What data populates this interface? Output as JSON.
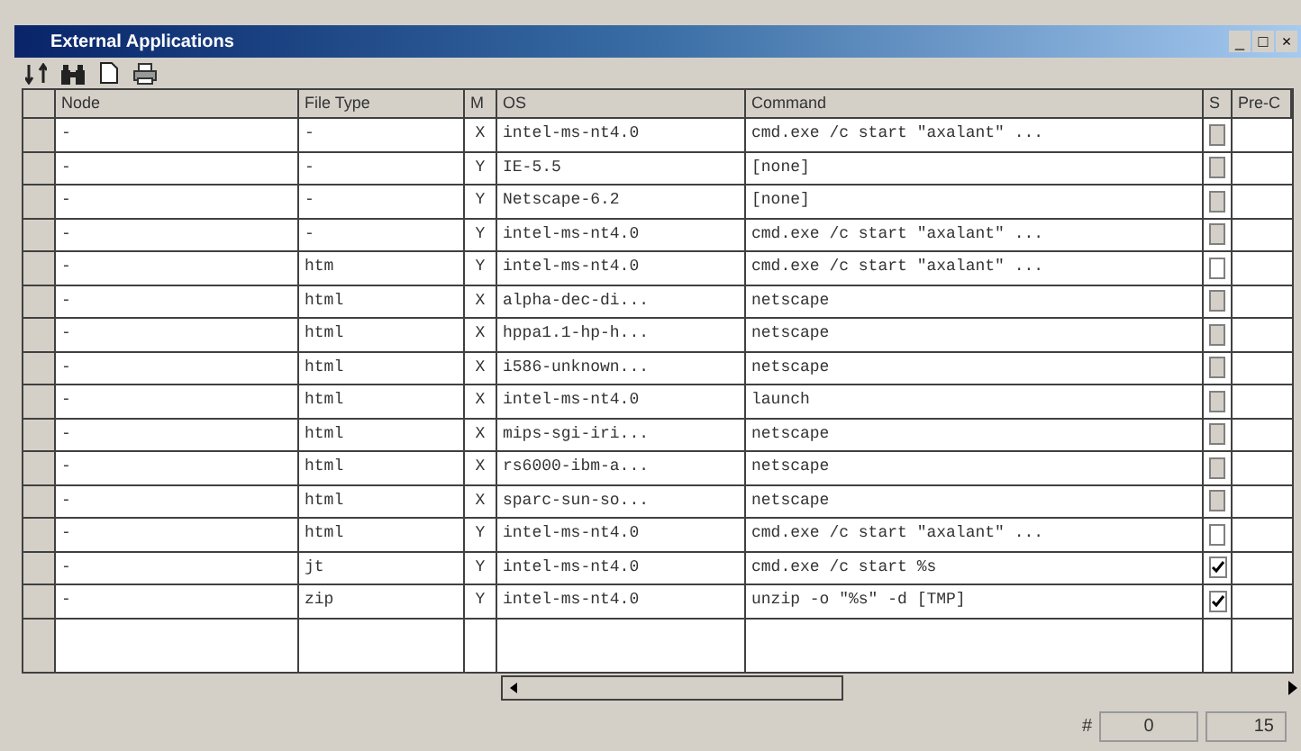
{
  "window": {
    "title": "External Applications",
    "controls": [
      "_",
      "□",
      "×"
    ]
  },
  "table": {
    "columns": [
      "Node",
      "File Type",
      "M",
      "OS",
      "Command",
      "S",
      "Pre-C"
    ],
    "rows": [
      {
        "node": "-",
        "file_type": "-",
        "m": "X",
        "os": "intel-ms-nt4.0",
        "command": "cmd.exe /c start \"axalant\" ...",
        "checked": false,
        "disabled": true
      },
      {
        "node": "-",
        "file_type": "-",
        "m": "Y",
        "os": "IE-5.5",
        "command": "[none]",
        "checked": false,
        "disabled": true
      },
      {
        "node": "-",
        "file_type": "-",
        "m": "Y",
        "os": "Netscape-6.2",
        "command": "[none]",
        "checked": false,
        "disabled": true
      },
      {
        "node": "-",
        "file_type": "-",
        "m": "Y",
        "os": "intel-ms-nt4.0",
        "command": "cmd.exe /c start \"axalant\" ...",
        "checked": false,
        "disabled": true
      },
      {
        "node": "-",
        "file_type": "htm",
        "m": "Y",
        "os": "intel-ms-nt4.0",
        "command": "cmd.exe /c start \"axalant\" ...",
        "checked": false,
        "disabled": false
      },
      {
        "node": "-",
        "file_type": "html",
        "m": "X",
        "os": "alpha-dec-di...",
        "command": "netscape",
        "checked": false,
        "disabled": true
      },
      {
        "node": "-",
        "file_type": "html",
        "m": "X",
        "os": "hppa1.1-hp-h...",
        "command": "netscape",
        "checked": false,
        "disabled": true
      },
      {
        "node": "-",
        "file_type": "html",
        "m": "X",
        "os": "i586-unknown...",
        "command": "netscape",
        "checked": false,
        "disabled": true
      },
      {
        "node": "-",
        "file_type": "html",
        "m": "X",
        "os": "intel-ms-nt4.0",
        "command": "launch",
        "checked": false,
        "disabled": true
      },
      {
        "node": "-",
        "file_type": "html",
        "m": "X",
        "os": "mips-sgi-iri...",
        "command": "netscape",
        "checked": false,
        "disabled": true
      },
      {
        "node": "-",
        "file_type": "html",
        "m": "X",
        "os": "rs6000-ibm-a...",
        "command": "netscape",
        "checked": false,
        "disabled": true
      },
      {
        "node": "-",
        "file_type": "html",
        "m": "X",
        "os": "sparc-sun-so...",
        "command": "netscape",
        "checked": false,
        "disabled": true
      },
      {
        "node": "-",
        "file_type": "html",
        "m": "Y",
        "os": "intel-ms-nt4.0",
        "command": "cmd.exe /c start \"axalant\" ...",
        "checked": false,
        "disabled": false
      },
      {
        "node": "-",
        "file_type": "jt",
        "m": "Y",
        "os": "intel-ms-nt4.0",
        "command": "cmd.exe /c start %s",
        "checked": true,
        "disabled": false
      },
      {
        "node": "-",
        "file_type": "zip",
        "m": "Y",
        "os": "intel-ms-nt4.0",
        "command": "unzip -o \"%s\" -d [TMP]",
        "checked": true,
        "disabled": false
      }
    ]
  },
  "status_bar": [
    "#",
    "0",
    "15"
  ]
}
